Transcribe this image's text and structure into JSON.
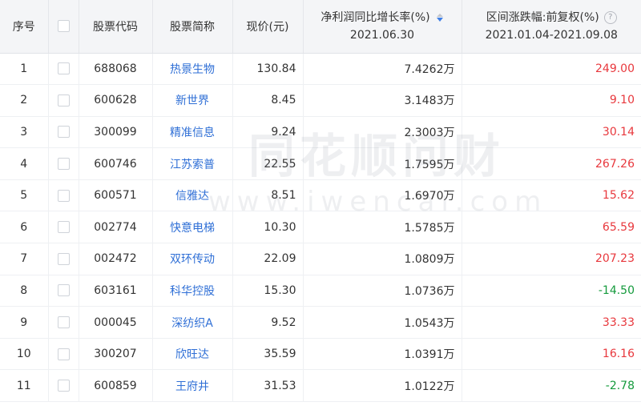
{
  "header": {
    "index": "序号",
    "code": "股票代码",
    "name": "股票简称",
    "price": "现价(元)",
    "growth_title": "净利润同比增长率(%)",
    "growth_date": "2021.06.30",
    "change_title": "区间涨跌幅:前复权(%)",
    "change_range": "2021.01.04-2021.09.08",
    "help_glyph": "?"
  },
  "watermark": {
    "cn": "同花顺问财",
    "en": "www.iwencai.com"
  },
  "colors": {
    "positive": "#e8383d",
    "negative": "#149a3c",
    "link": "#2f6fd6",
    "sort_active": "#3f7fe6"
  },
  "rows": [
    {
      "index": "1",
      "code": "688068",
      "name": "热景生物",
      "price": "130.84",
      "growth": "7.4262万",
      "change": "249.00",
      "dir": "pos"
    },
    {
      "index": "2",
      "code": "600628",
      "name": "新世界",
      "price": "8.45",
      "growth": "3.1483万",
      "change": "9.10",
      "dir": "pos"
    },
    {
      "index": "3",
      "code": "300099",
      "name": "精准信息",
      "price": "9.24",
      "growth": "2.3003万",
      "change": "30.14",
      "dir": "pos"
    },
    {
      "index": "4",
      "code": "600746",
      "name": "江苏索普",
      "price": "22.55",
      "growth": "1.7595万",
      "change": "267.26",
      "dir": "pos"
    },
    {
      "index": "5",
      "code": "600571",
      "name": "信雅达",
      "price": "8.51",
      "growth": "1.6970万",
      "change": "15.62",
      "dir": "pos"
    },
    {
      "index": "6",
      "code": "002774",
      "name": "快意电梯",
      "price": "10.30",
      "growth": "1.5785万",
      "change": "65.59",
      "dir": "pos"
    },
    {
      "index": "7",
      "code": "002472",
      "name": "双环传动",
      "price": "22.09",
      "growth": "1.0809万",
      "change": "207.23",
      "dir": "pos"
    },
    {
      "index": "8",
      "code": "603161",
      "name": "科华控股",
      "price": "15.30",
      "growth": "1.0736万",
      "change": "-14.50",
      "dir": "neg"
    },
    {
      "index": "9",
      "code": "000045",
      "name": "深纺织A",
      "price": "9.52",
      "growth": "1.0543万",
      "change": "33.33",
      "dir": "pos"
    },
    {
      "index": "10",
      "code": "300207",
      "name": "欣旺达",
      "price": "35.59",
      "growth": "1.0391万",
      "change": "16.16",
      "dir": "pos"
    },
    {
      "index": "11",
      "code": "600859",
      "name": "王府井",
      "price": "31.53",
      "growth": "1.0122万",
      "change": "-2.78",
      "dir": "neg"
    }
  ]
}
